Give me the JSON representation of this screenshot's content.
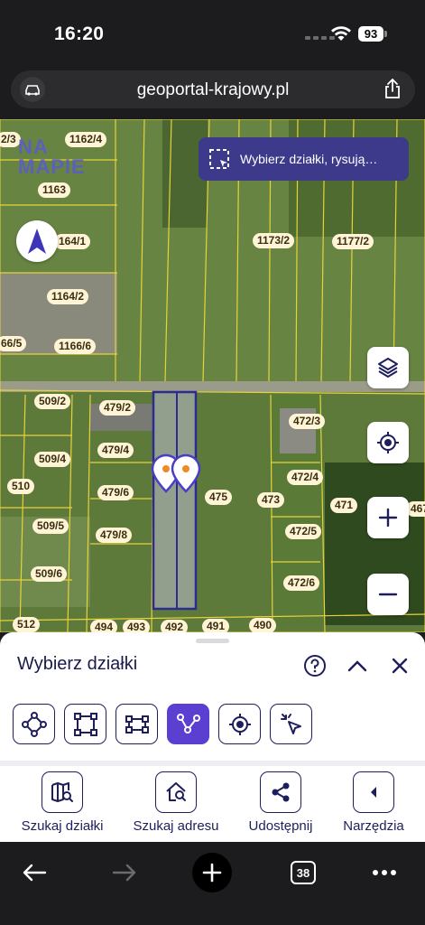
{
  "status_bar": {
    "time": "16:20",
    "battery": "93"
  },
  "browser": {
    "url": "geoportal-krajowy.pl",
    "tab_count": "38"
  },
  "map": {
    "logo_line1": "NA",
    "logo_line2": "MAPIE",
    "select_banner": "Wybierz działki, rysują…",
    "parcel_labels": [
      "2/3",
      "1162/4",
      "1163",
      "164/1",
      "1173/2",
      "1177/2",
      "1164/2",
      "66/5",
      "1166/6",
      "509/2",
      "479/2",
      "472/3",
      "509/4",
      "479/4",
      "510",
      "479/6",
      "475",
      "473",
      "472/4",
      "471",
      "467",
      "509/5",
      "479/8",
      "472/5",
      "509/6",
      "472/6",
      "512",
      "494",
      "493",
      "492",
      "491",
      "490"
    ]
  },
  "panel": {
    "title": "Wybierz działki",
    "tools": [
      {
        "icon": "polygon-select-icon",
        "active": false
      },
      {
        "icon": "rectangle-select-icon",
        "active": false
      },
      {
        "icon": "wide-rectangle-select-icon",
        "active": false
      },
      {
        "icon": "line-select-icon",
        "active": true
      },
      {
        "icon": "point-select-icon",
        "active": false
      },
      {
        "icon": "click-select-icon",
        "active": false
      }
    ],
    "actions": [
      {
        "label": "Szukaj działki",
        "icon": "map-search-icon"
      },
      {
        "label": "Szukaj adresu",
        "icon": "home-search-icon"
      },
      {
        "label": "Udostępnij",
        "icon": "share-icon"
      },
      {
        "label": "Narzędzia",
        "icon": "chevron-left-icon"
      }
    ]
  },
  "colors": {
    "accent": "#5b3fd1",
    "banner": "#3d3a8c",
    "navy": "#1e1e5c",
    "parcel_line": "#e8d23a"
  }
}
